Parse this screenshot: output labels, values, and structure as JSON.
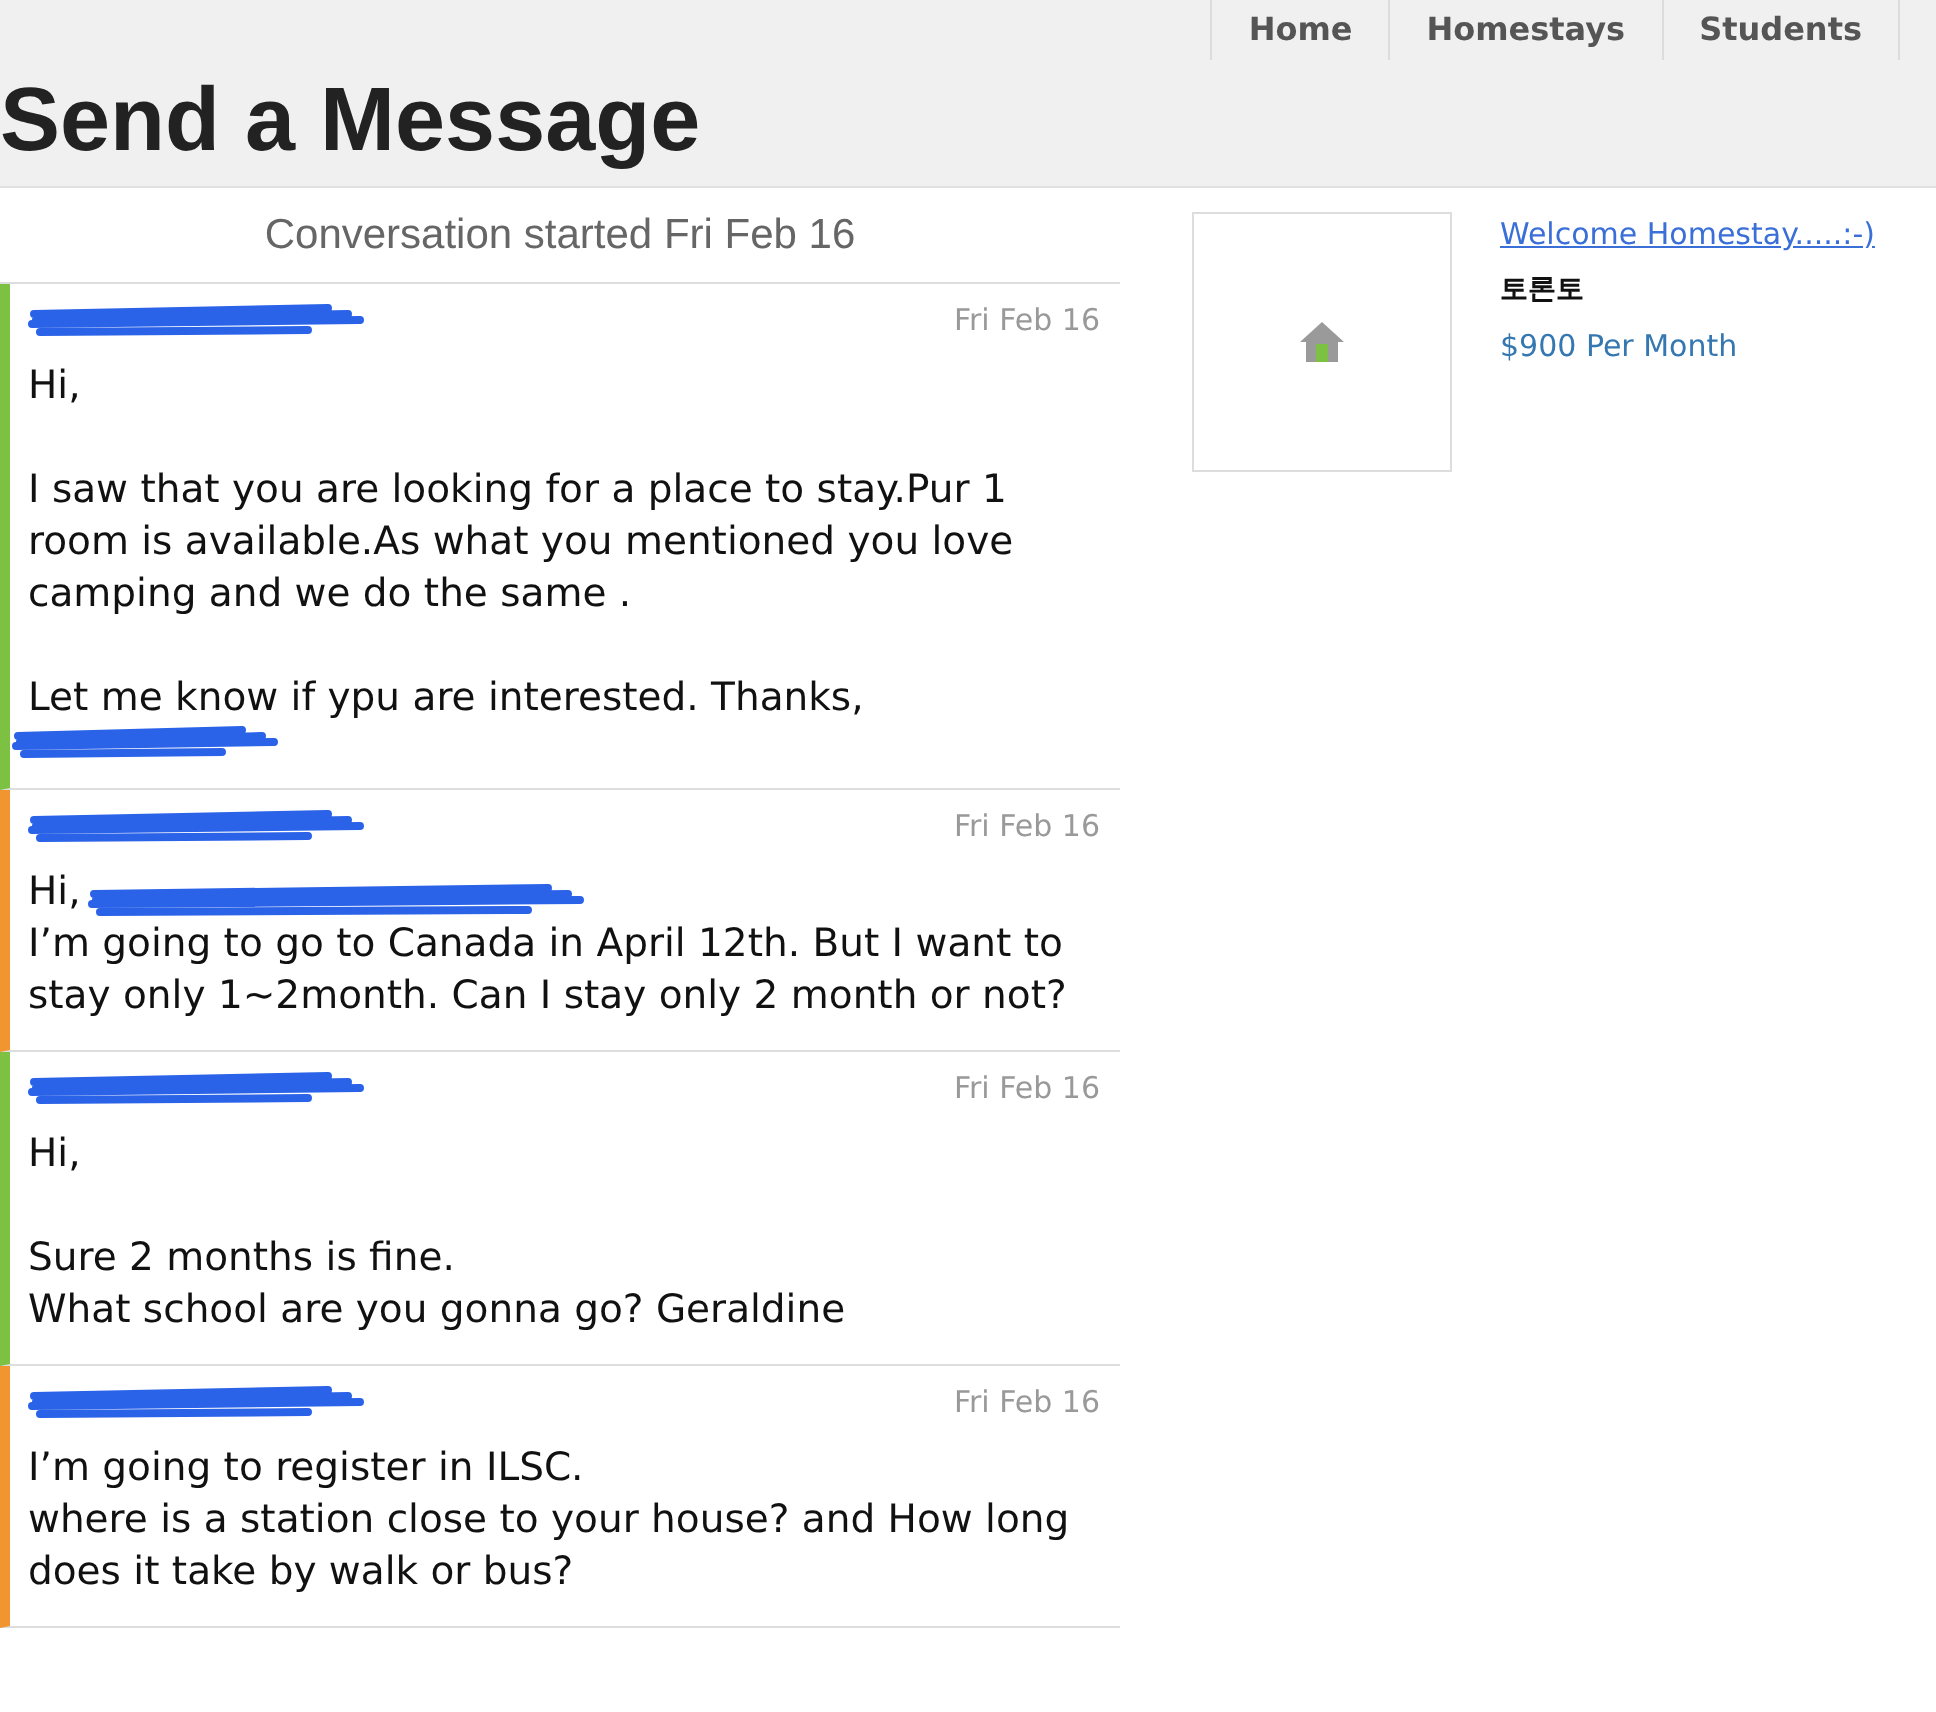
{
  "nav": {
    "tabs": [
      {
        "label": "Home",
        "selected": false
      },
      {
        "label": "Homestays",
        "selected": false
      },
      {
        "label": "Students",
        "selected": false
      }
    ]
  },
  "page_title": "Send a Message",
  "conversation": {
    "header": "Conversation started Fri Feb 16",
    "messages": [
      {
        "color": "#7dc142",
        "date": "Fri Feb 16",
        "paragraphs": [
          [
            [
              {
                "kind": "text",
                "text": "Hi,"
              }
            ]
          ],
          [
            [
              {
                "kind": "text",
                "text": "I saw that you are looking for a place to stay.Pur 1 room is available.As what you mentioned you love camping and we do the same ."
              }
            ]
          ],
          [
            [
              {
                "kind": "text",
                "text": "Let me know if ypu are interested. Thanks,"
              }
            ],
            [
              {
                "kind": "redaction"
              }
            ]
          ]
        ]
      },
      {
        "color": "#f0952f",
        "date": "Fri Feb 16",
        "paragraphs": [
          [
            [
              {
                "kind": "text",
                "text": "Hi,"
              },
              {
                "kind": "redaction"
              }
            ],
            [
              {
                "kind": "text",
                "text": "I’m going to go to Canada in April 12th. But I want to stay only 1~2month. Can I stay only 2 month or not?"
              }
            ]
          ]
        ]
      },
      {
        "color": "#7dc142",
        "date": "Fri Feb 16",
        "paragraphs": [
          [
            [
              {
                "kind": "text",
                "text": "Hi,"
              }
            ]
          ],
          [
            [
              {
                "kind": "text",
                "text": "Sure 2 months is fine."
              }
            ],
            [
              {
                "kind": "text",
                "text": "What school are you gonna go? Geraldine"
              }
            ]
          ]
        ]
      },
      {
        "color": "#f0952f",
        "date": "Fri Feb 16",
        "paragraphs": [
          [
            [
              {
                "kind": "text",
                "text": "I’m going to register in ILSC."
              }
            ],
            [
              {
                "kind": "text",
                "text": "where is a station close to your house? and How long does it take by walk or bus?"
              }
            ]
          ]
        ]
      }
    ]
  },
  "listing": {
    "title": "Welcome Homestay.....:-)",
    "city": "토론토",
    "price": "$900 Per Month"
  }
}
